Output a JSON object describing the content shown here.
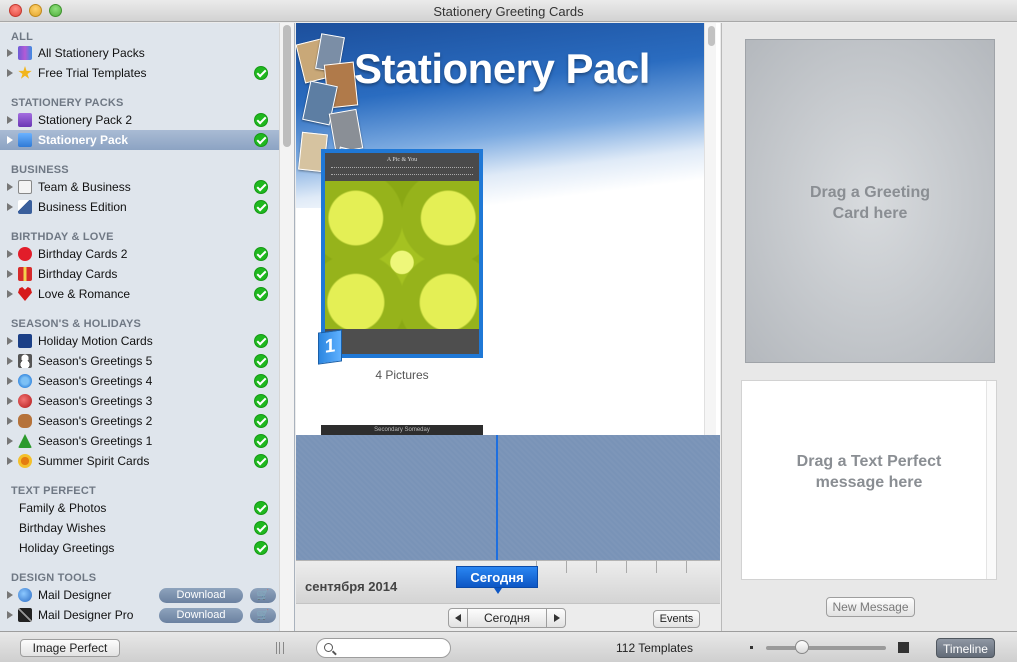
{
  "window": {
    "title": "Stationery Greeting Cards"
  },
  "sidebar": {
    "sections": [
      {
        "header": "ALL",
        "items": [
          {
            "label": "All Stationery Packs",
            "icon": "books-icon",
            "check": false
          },
          {
            "label": "Free Trial Templates",
            "icon": "star-icon",
            "check": true
          }
        ]
      },
      {
        "header": "STATIONERY PACKS",
        "items": [
          {
            "label": "Stationery Pack 2",
            "icon": "purple-pack-icon",
            "check": true
          },
          {
            "label": "Stationery Pack",
            "icon": "blue-pack-icon",
            "check": true,
            "selected": true
          }
        ]
      },
      {
        "header": "BUSINESS",
        "items": [
          {
            "label": "Team & Business",
            "icon": "document-icon",
            "check": true
          },
          {
            "label": "Business Edition",
            "icon": "stack-icon",
            "check": true
          }
        ]
      },
      {
        "header": "BIRTHDAY & LOVE",
        "items": [
          {
            "label": "Birthday Cards 2",
            "icon": "balloon-icon",
            "check": true
          },
          {
            "label": "Birthday Cards",
            "icon": "gift-icon",
            "check": true
          },
          {
            "label": "Love & Romance",
            "icon": "heart-icon",
            "check": true
          }
        ]
      },
      {
        "header": "SEASON'S & HOLIDAYS",
        "items": [
          {
            "label": "Holiday Motion Cards",
            "icon": "film-icon",
            "check": true
          },
          {
            "label": "Season's Greetings 5",
            "icon": "snowman-icon",
            "check": true
          },
          {
            "label": "Season's Greetings 4",
            "icon": "snowflake-icon",
            "check": true
          },
          {
            "label": "Season's Greetings 3",
            "icon": "ornament-icon",
            "check": true
          },
          {
            "label": "Season's Greetings 2",
            "icon": "gingerbread-icon",
            "check": true
          },
          {
            "label": "Season's Greetings 1",
            "icon": "tree-icon",
            "check": true
          },
          {
            "label": "Summer Spirit Cards",
            "icon": "sun-icon",
            "check": true
          }
        ]
      },
      {
        "header": "TEXT PERFECT",
        "items": [
          {
            "label": "Family & Photos",
            "check": true,
            "nodisc": true
          },
          {
            "label": "Birthday Wishes",
            "check": true,
            "nodisc": true
          },
          {
            "label": "Holiday Greetings",
            "check": true,
            "nodisc": true
          }
        ]
      },
      {
        "header": "DESIGN TOOLS",
        "items": [
          {
            "label": "Mail Designer",
            "icon": "mail-designer-icon",
            "download": "Download"
          },
          {
            "label": "Mail Designer Pro",
            "icon": "pen-icon",
            "download": "Download"
          }
        ]
      }
    ],
    "cart_glyph": "🛒"
  },
  "browser": {
    "banner_title": "Stationery Pacl",
    "card1": {
      "title": "A Pic & You",
      "badge": "1",
      "caption": "4 Pictures"
    },
    "card2": {
      "title": "Secondary Someday"
    }
  },
  "timeline": {
    "month": "сентября 2014",
    "today_tag": "Сегодня",
    "nav_today": "Сегодня",
    "events_label": "Events"
  },
  "right_panel": {
    "card_drop_line1": "Drag a Greeting",
    "card_drop_line2": "Card here",
    "msg_drop_line1": "Drag a Text Perfect",
    "msg_drop_line2": "message here",
    "new_message": "New Message"
  },
  "bottom_bar": {
    "image_perfect": "Image Perfect",
    "search_placeholder": "",
    "count": "112 Templates",
    "zoom_level": 0.27,
    "timeline_button": "Timeline"
  },
  "colors": {
    "accent": "#1f78d6",
    "check": "#1fb81f",
    "sidebar_bg": "#dfe5ec"
  }
}
